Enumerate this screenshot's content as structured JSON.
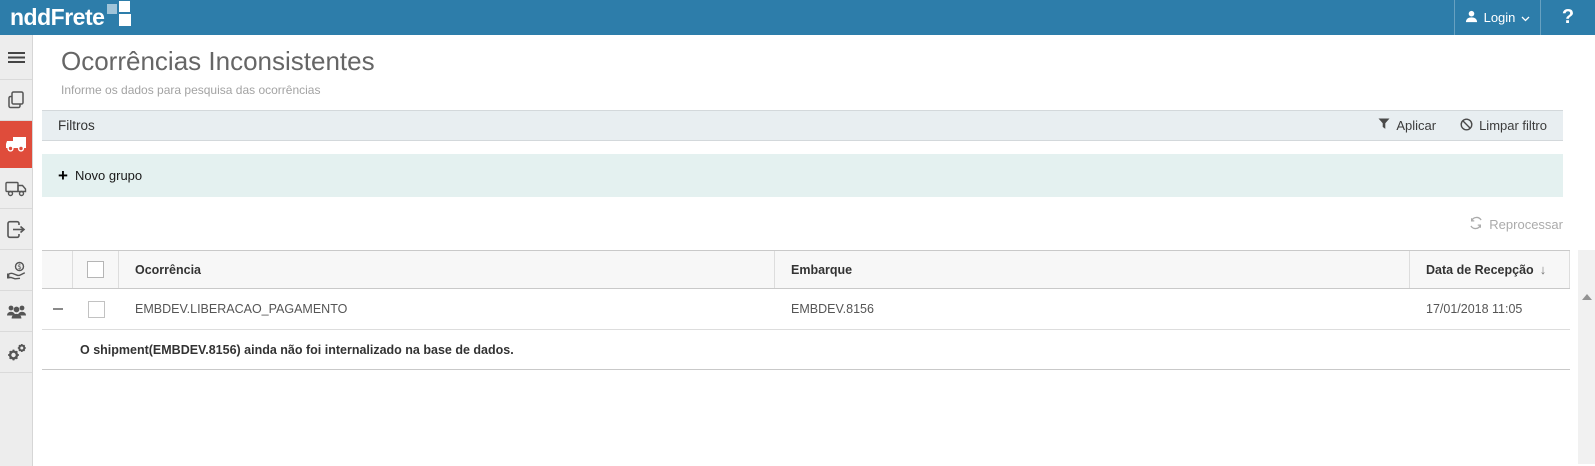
{
  "header": {
    "logo": "nddFrete",
    "login": "Login",
    "help": "?"
  },
  "sidebar": {
    "items": [
      {
        "id": "menu-toggle",
        "icon": "hamburger-icon",
        "active": false
      },
      {
        "id": "documents",
        "icon": "copy-icon",
        "active": false
      },
      {
        "id": "freight-occurrences",
        "icon": "truck-icon",
        "active": true
      },
      {
        "id": "delivery",
        "icon": "delivery-truck-icon",
        "active": false
      },
      {
        "id": "export",
        "icon": "export-icon",
        "active": false
      },
      {
        "id": "payments",
        "icon": "hand-coin-icon",
        "active": false
      },
      {
        "id": "users",
        "icon": "users-icon",
        "active": false
      },
      {
        "id": "settings",
        "icon": "gears-icon",
        "active": false
      }
    ]
  },
  "page": {
    "title": "Ocorrências Inconsistentes",
    "subtitle": "Informe os dados para pesquisa das ocorrências"
  },
  "filters": {
    "label": "Filtros",
    "apply": "Aplicar",
    "clear": "Limpar filtro"
  },
  "toolbar": {
    "new_group": "Novo grupo",
    "reprocess": "Reprocessar",
    "reprocess_enabled": false
  },
  "grid": {
    "columns": [
      {
        "label": "Ocorrência"
      },
      {
        "label": "Embarque"
      },
      {
        "label": "Data de Recepção",
        "sorted": "desc"
      }
    ],
    "rows": [
      {
        "expanded": true,
        "checked": false,
        "ocorrencia": "EMBDEV.LIBERACAO_PAGAMENTO",
        "embarque": "EMBDEV.8156",
        "data_recepcao": "17/01/2018 11:05",
        "detail": "O shipment(EMBDEV.8156) ainda não foi internalizado na base de dados."
      }
    ]
  },
  "icons": {
    "plus": "+",
    "sort_desc": "↓"
  },
  "colors": {
    "header_bg": "#2d7daa",
    "active_item_bg": "#df4c3b",
    "filters_bar_bg": "#e8eef1",
    "group_bar_bg": "#e4f1f0"
  }
}
